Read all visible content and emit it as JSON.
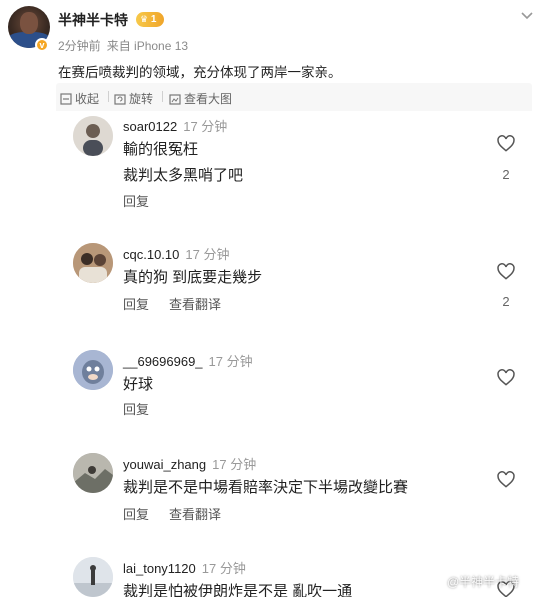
{
  "post": {
    "author": "半神半卡特",
    "badge_level": "1",
    "time": "2分钟前",
    "source": "来自 iPhone 13",
    "text": "在赛后喷裁判的领域，充分体现了两岸一家亲。"
  },
  "toolbar": {
    "collapse": "收起",
    "rotate": "旋转",
    "view_large": "查看大图"
  },
  "comments": [
    {
      "user": "soar0122",
      "time": "17 分钟",
      "lines": [
        "輸的很冤枉",
        "裁判太多黑哨了吧"
      ],
      "reply": "回复",
      "translate": "",
      "likes": "2"
    },
    {
      "user": "cqc.10.10",
      "time": "17 分钟",
      "lines": [
        "真的狗 到底要走幾步"
      ],
      "reply": "回复",
      "translate": "查看翻译",
      "likes": "2"
    },
    {
      "user": "__69696969_",
      "time": "17 分钟",
      "lines": [
        "好球"
      ],
      "reply": "回复",
      "translate": "",
      "likes": ""
    },
    {
      "user": "youwai_zhang",
      "time": "17 分钟",
      "lines": [
        "裁判是不是中場看賠率決定下半場改變比賽"
      ],
      "reply": "回复",
      "translate": "查看翻译",
      "likes": ""
    },
    {
      "user": "lai_tony1120",
      "time": "17 分钟",
      "lines": [
        "裁判是怕被伊朗炸是不是 亂吹一通"
      ],
      "reply": "",
      "translate": "",
      "likes": ""
    }
  ],
  "watermark": "@半神半卡特",
  "icons": {
    "collapse": "collapse-icon",
    "rotate": "rotate-icon",
    "view_large": "image-icon",
    "like": "heart-icon",
    "more": "chevron-down-icon",
    "verified": "verified-badge-icon"
  },
  "colors": {
    "badge": "#f0a52a",
    "verified": "#f5a623",
    "panel": "#f7f7f7"
  }
}
